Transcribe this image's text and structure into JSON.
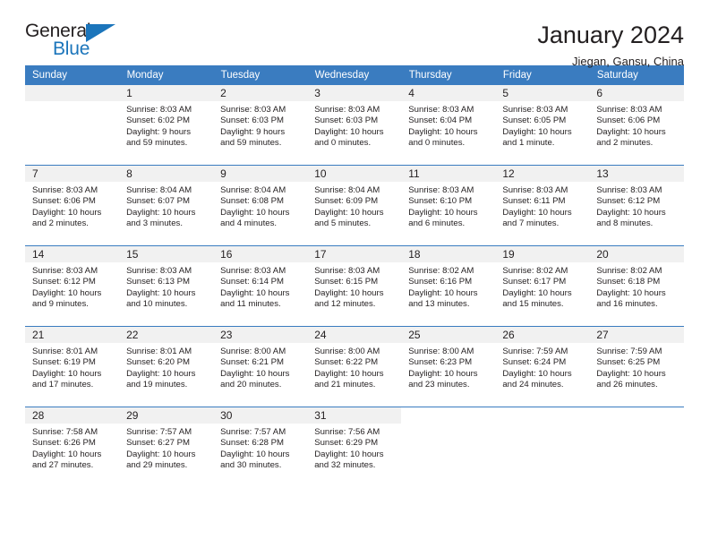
{
  "logo": {
    "primary_text": "General",
    "secondary_text": "Blue",
    "triangle_color": "#1b75bb"
  },
  "header": {
    "title": "January 2024",
    "location": "Jiegan, Gansu, China"
  },
  "theme": {
    "header_blue": "#3a7cc0",
    "daynum_background": "#f1f1f1",
    "text_color": "#231f20"
  },
  "calendar": {
    "weekday_headers": [
      "Sunday",
      "Monday",
      "Tuesday",
      "Wednesday",
      "Thursday",
      "Friday",
      "Saturday"
    ],
    "weeks": [
      [
        {
          "day": "",
          "sunrise": "",
          "sunset": "",
          "daylight_line1": "",
          "daylight_line2": "",
          "empty": true
        },
        {
          "day": "1",
          "sunrise": "Sunrise: 8:03 AM",
          "sunset": "Sunset: 6:02 PM",
          "daylight_line1": "Daylight: 9 hours",
          "daylight_line2": "and 59 minutes."
        },
        {
          "day": "2",
          "sunrise": "Sunrise: 8:03 AM",
          "sunset": "Sunset: 6:03 PM",
          "daylight_line1": "Daylight: 9 hours",
          "daylight_line2": "and 59 minutes."
        },
        {
          "day": "3",
          "sunrise": "Sunrise: 8:03 AM",
          "sunset": "Sunset: 6:03 PM",
          "daylight_line1": "Daylight: 10 hours",
          "daylight_line2": "and 0 minutes."
        },
        {
          "day": "4",
          "sunrise": "Sunrise: 8:03 AM",
          "sunset": "Sunset: 6:04 PM",
          "daylight_line1": "Daylight: 10 hours",
          "daylight_line2": "and 0 minutes."
        },
        {
          "day": "5",
          "sunrise": "Sunrise: 8:03 AM",
          "sunset": "Sunset: 6:05 PM",
          "daylight_line1": "Daylight: 10 hours",
          "daylight_line2": "and 1 minute."
        },
        {
          "day": "6",
          "sunrise": "Sunrise: 8:03 AM",
          "sunset": "Sunset: 6:06 PM",
          "daylight_line1": "Daylight: 10 hours",
          "daylight_line2": "and 2 minutes."
        }
      ],
      [
        {
          "day": "7",
          "sunrise": "Sunrise: 8:03 AM",
          "sunset": "Sunset: 6:06 PM",
          "daylight_line1": "Daylight: 10 hours",
          "daylight_line2": "and 2 minutes."
        },
        {
          "day": "8",
          "sunrise": "Sunrise: 8:04 AM",
          "sunset": "Sunset: 6:07 PM",
          "daylight_line1": "Daylight: 10 hours",
          "daylight_line2": "and 3 minutes."
        },
        {
          "day": "9",
          "sunrise": "Sunrise: 8:04 AM",
          "sunset": "Sunset: 6:08 PM",
          "daylight_line1": "Daylight: 10 hours",
          "daylight_line2": "and 4 minutes."
        },
        {
          "day": "10",
          "sunrise": "Sunrise: 8:04 AM",
          "sunset": "Sunset: 6:09 PM",
          "daylight_line1": "Daylight: 10 hours",
          "daylight_line2": "and 5 minutes."
        },
        {
          "day": "11",
          "sunrise": "Sunrise: 8:03 AM",
          "sunset": "Sunset: 6:10 PM",
          "daylight_line1": "Daylight: 10 hours",
          "daylight_line2": "and 6 minutes."
        },
        {
          "day": "12",
          "sunrise": "Sunrise: 8:03 AM",
          "sunset": "Sunset: 6:11 PM",
          "daylight_line1": "Daylight: 10 hours",
          "daylight_line2": "and 7 minutes."
        },
        {
          "day": "13",
          "sunrise": "Sunrise: 8:03 AM",
          "sunset": "Sunset: 6:12 PM",
          "daylight_line1": "Daylight: 10 hours",
          "daylight_line2": "and 8 minutes."
        }
      ],
      [
        {
          "day": "14",
          "sunrise": "Sunrise: 8:03 AM",
          "sunset": "Sunset: 6:12 PM",
          "daylight_line1": "Daylight: 10 hours",
          "daylight_line2": "and 9 minutes."
        },
        {
          "day": "15",
          "sunrise": "Sunrise: 8:03 AM",
          "sunset": "Sunset: 6:13 PM",
          "daylight_line1": "Daylight: 10 hours",
          "daylight_line2": "and 10 minutes."
        },
        {
          "day": "16",
          "sunrise": "Sunrise: 8:03 AM",
          "sunset": "Sunset: 6:14 PM",
          "daylight_line1": "Daylight: 10 hours",
          "daylight_line2": "and 11 minutes."
        },
        {
          "day": "17",
          "sunrise": "Sunrise: 8:03 AM",
          "sunset": "Sunset: 6:15 PM",
          "daylight_line1": "Daylight: 10 hours",
          "daylight_line2": "and 12 minutes."
        },
        {
          "day": "18",
          "sunrise": "Sunrise: 8:02 AM",
          "sunset": "Sunset: 6:16 PM",
          "daylight_line1": "Daylight: 10 hours",
          "daylight_line2": "and 13 minutes."
        },
        {
          "day": "19",
          "sunrise": "Sunrise: 8:02 AM",
          "sunset": "Sunset: 6:17 PM",
          "daylight_line1": "Daylight: 10 hours",
          "daylight_line2": "and 15 minutes."
        },
        {
          "day": "20",
          "sunrise": "Sunrise: 8:02 AM",
          "sunset": "Sunset: 6:18 PM",
          "daylight_line1": "Daylight: 10 hours",
          "daylight_line2": "and 16 minutes."
        }
      ],
      [
        {
          "day": "21",
          "sunrise": "Sunrise: 8:01 AM",
          "sunset": "Sunset: 6:19 PM",
          "daylight_line1": "Daylight: 10 hours",
          "daylight_line2": "and 17 minutes."
        },
        {
          "day": "22",
          "sunrise": "Sunrise: 8:01 AM",
          "sunset": "Sunset: 6:20 PM",
          "daylight_line1": "Daylight: 10 hours",
          "daylight_line2": "and 19 minutes."
        },
        {
          "day": "23",
          "sunrise": "Sunrise: 8:00 AM",
          "sunset": "Sunset: 6:21 PM",
          "daylight_line1": "Daylight: 10 hours",
          "daylight_line2": "and 20 minutes."
        },
        {
          "day": "24",
          "sunrise": "Sunrise: 8:00 AM",
          "sunset": "Sunset: 6:22 PM",
          "daylight_line1": "Daylight: 10 hours",
          "daylight_line2": "and 21 minutes."
        },
        {
          "day": "25",
          "sunrise": "Sunrise: 8:00 AM",
          "sunset": "Sunset: 6:23 PM",
          "daylight_line1": "Daylight: 10 hours",
          "daylight_line2": "and 23 minutes."
        },
        {
          "day": "26",
          "sunrise": "Sunrise: 7:59 AM",
          "sunset": "Sunset: 6:24 PM",
          "daylight_line1": "Daylight: 10 hours",
          "daylight_line2": "and 24 minutes."
        },
        {
          "day": "27",
          "sunrise": "Sunrise: 7:59 AM",
          "sunset": "Sunset: 6:25 PM",
          "daylight_line1": "Daylight: 10 hours",
          "daylight_line2": "and 26 minutes."
        }
      ],
      [
        {
          "day": "28",
          "sunrise": "Sunrise: 7:58 AM",
          "sunset": "Sunset: 6:26 PM",
          "daylight_line1": "Daylight: 10 hours",
          "daylight_line2": "and 27 minutes."
        },
        {
          "day": "29",
          "sunrise": "Sunrise: 7:57 AM",
          "sunset": "Sunset: 6:27 PM",
          "daylight_line1": "Daylight: 10 hours",
          "daylight_line2": "and 29 minutes."
        },
        {
          "day": "30",
          "sunrise": "Sunrise: 7:57 AM",
          "sunset": "Sunset: 6:28 PM",
          "daylight_line1": "Daylight: 10 hours",
          "daylight_line2": "and 30 minutes."
        },
        {
          "day": "31",
          "sunrise": "Sunrise: 7:56 AM",
          "sunset": "Sunset: 6:29 PM",
          "daylight_line1": "Daylight: 10 hours",
          "daylight_line2": "and 32 minutes."
        },
        {
          "day": "",
          "sunrise": "",
          "sunset": "",
          "daylight_line1": "",
          "daylight_line2": "",
          "blank": true
        },
        {
          "day": "",
          "sunrise": "",
          "sunset": "",
          "daylight_line1": "",
          "daylight_line2": "",
          "blank": true
        },
        {
          "day": "",
          "sunrise": "",
          "sunset": "",
          "daylight_line1": "",
          "daylight_line2": "",
          "blank": true
        }
      ]
    ]
  }
}
